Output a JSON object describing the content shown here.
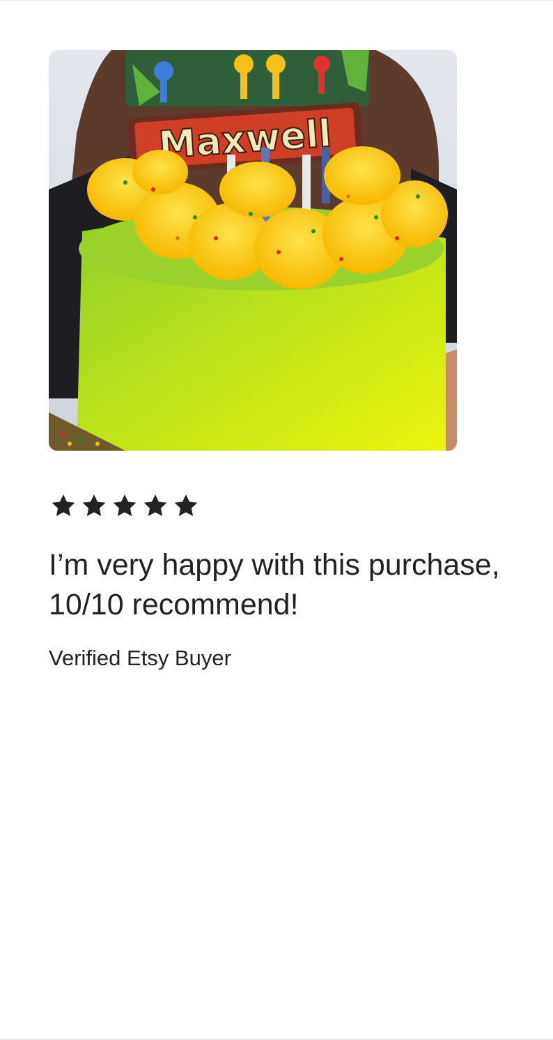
{
  "review": {
    "photo": {
      "icon": "product-photo",
      "topper_text": "Maxwell",
      "colors": {
        "cake": "#b9e015",
        "frosting": "#ffd21f",
        "background": "#d8dde6"
      }
    },
    "rating": {
      "value": 5,
      "max": 5,
      "star_color": "#222222"
    },
    "text": "I’m very happy with this purchase, 10/10 recommend!",
    "reviewer": "Verified Etsy Buyer"
  }
}
